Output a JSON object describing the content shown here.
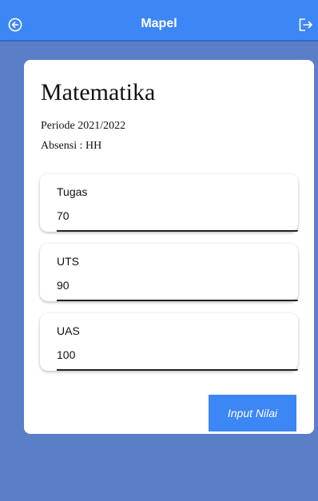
{
  "appbar": {
    "title": "Mapel",
    "back_icon": "arrow-left-circle-icon",
    "logout_icon": "logout-icon",
    "color": "#3c86f5"
  },
  "detail": {
    "subject": "Matematika",
    "period": "Periode 2021/2022",
    "absensi": "Absensi : HH"
  },
  "scores": [
    {
      "label": "Tugas",
      "value": "70"
    },
    {
      "label": "UTS",
      "value": "90"
    },
    {
      "label": "UAS",
      "value": "100"
    }
  ],
  "actions": {
    "submit_label": "Input Nilai"
  },
  "colors": {
    "background": "#5a7fc6",
    "accent": "#3c86f5"
  }
}
